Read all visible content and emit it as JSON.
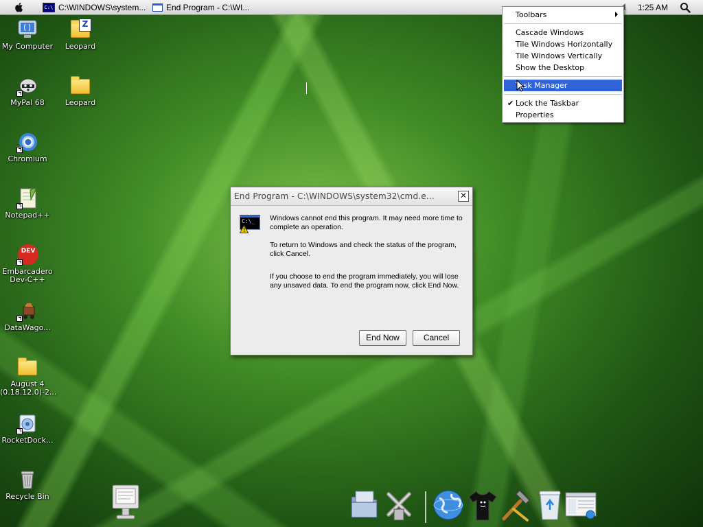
{
  "menubar": {
    "tasks": [
      {
        "icon": "cmd-icon",
        "icon_text": "C:\\",
        "label": "C:\\WINDOWS\\system..."
      },
      {
        "icon": "window-icon",
        "label": "End Program - C:\\WI..."
      }
    ],
    "clock": "1:25 AM"
  },
  "context_menu": {
    "items": [
      {
        "label": "Toolbars",
        "submenu": true
      },
      {
        "label": "Cascade Windows"
      },
      {
        "label": "Tile Windows Horizontally"
      },
      {
        "label": "Tile Windows Vertically"
      },
      {
        "label": "Show the Desktop"
      },
      {
        "label": "Task Manager",
        "selected": true
      },
      {
        "label": "Lock the Taskbar",
        "checked": true
      },
      {
        "label": "Properties"
      }
    ],
    "check_mark": "✔",
    "highlight_color": "#3164d8"
  },
  "desktop_icons": [
    {
      "label": "My Computer",
      "icon": "computer-icon"
    },
    {
      "label": "Leopard",
      "icon": "zip-icon",
      "badge": "Z"
    },
    {
      "label": "MyPal 68",
      "icon": "mypal-icon"
    },
    {
      "label": "Leopard",
      "icon": "folder-icon"
    },
    {
      "label": "Chromium",
      "icon": "chromium-icon"
    },
    {
      "label": "Notepad++",
      "icon": "notepad-icon",
      "badge": "++"
    },
    {
      "label": "Embarcadero Dev-C++",
      "line1": "Embarcadero",
      "line2": "Dev-C++",
      "icon": "devcpp-icon",
      "badge": "DEV"
    },
    {
      "label": "DataWago...",
      "icon": "datawagon-icon"
    },
    {
      "label": "August 4 (0.18.12.0)-2...",
      "line1": "August 4",
      "line2": "(0.18.12.0)-2...",
      "icon": "folder-icon"
    },
    {
      "label": "RocketDock...",
      "icon": "rocketdock-icon"
    },
    {
      "label": "Recycle Bin",
      "icon": "recycle-bin-icon"
    }
  ],
  "dialog": {
    "title": "End Program - C:\\WINDOWS\\system32\\cmd.e...",
    "close_glyph": "✕",
    "icon_text": "C:\\_",
    "paragraphs": [
      "Windows cannot end this program. It may need more time to complete an operation.",
      "To return to Windows and check the status of the program, click Cancel.",
      "If you choose to end the program immediately, you will lose any unsaved data. To end the program now, click End Now."
    ],
    "buttons": {
      "end_now": "End Now",
      "cancel": "Cancel"
    }
  },
  "dock": {
    "items": [
      {
        "icon": "monitor-icon"
      },
      {
        "icon": "finder-folder-icon"
      },
      {
        "icon": "xcode-tools-icon"
      },
      {
        "icon": "globe-icon"
      },
      {
        "icon": "tshirt-icon"
      },
      {
        "icon": "hammer-icon"
      },
      {
        "icon": "recycle-bin-icon"
      },
      {
        "icon": "explorer-window-icon"
      }
    ]
  }
}
